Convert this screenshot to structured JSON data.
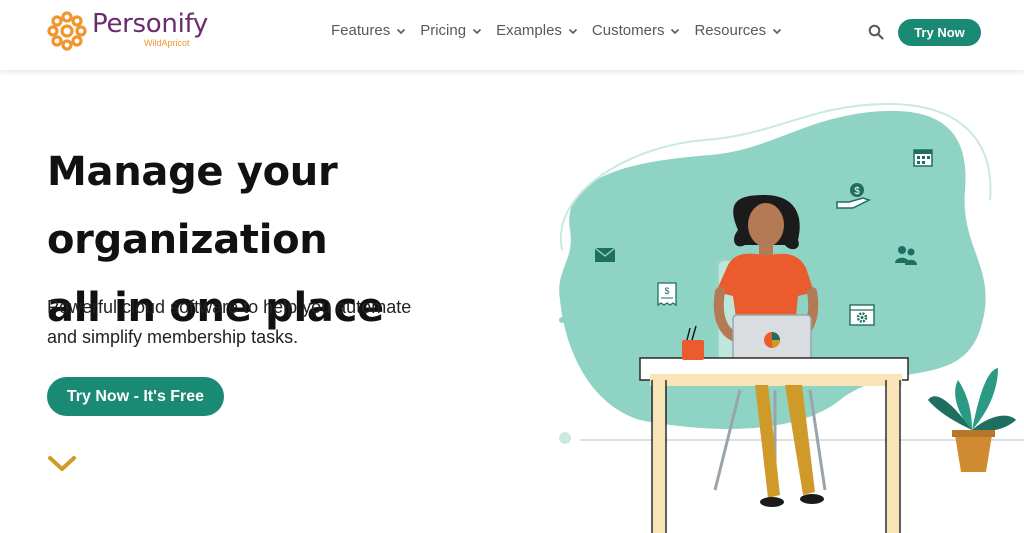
{
  "brand": {
    "name": "Personify",
    "sub": "WildApricot",
    "colors": {
      "purple": "#6b2c6e",
      "orange": "#f0962c",
      "teal": "#1a8a74",
      "blob": "#8fd3c5"
    }
  },
  "nav": {
    "items": [
      {
        "label": "Features",
        "icon": "chevron-down-icon"
      },
      {
        "label": "Pricing",
        "icon": "chevron-down-icon"
      },
      {
        "label": "Examples",
        "icon": "chevron-down-icon"
      },
      {
        "label": "Customers",
        "icon": "chevron-down-icon"
      },
      {
        "label": "Resources",
        "icon": "chevron-down-icon"
      }
    ],
    "search_icon": "search-icon",
    "cta_label": "Try Now"
  },
  "hero": {
    "title_line1": "Manage your organization",
    "title_line2": "all in one place",
    "subtitle_line1": "Powerful cloud software to help you automate",
    "subtitle_line2": "and simplify membership tasks.",
    "cta_label": "Try Now - It's Free",
    "scroll_icon": "chevron-down-icon"
  },
  "illustration": {
    "icons": [
      "calendar-icon",
      "money-hand-icon",
      "envelope-icon",
      "users-icon",
      "receipt-icon",
      "settings-window-icon",
      "laptop-icon",
      "pen-cup-icon",
      "plant-icon"
    ],
    "receipt_symbol": "$",
    "money_symbol": "$"
  }
}
